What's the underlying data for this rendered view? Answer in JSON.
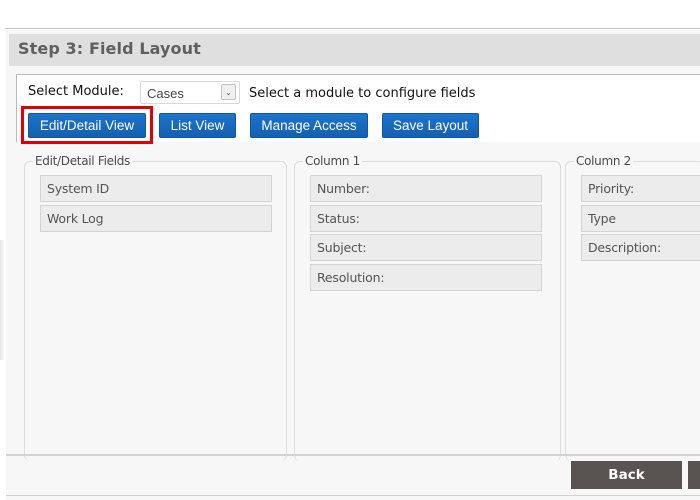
{
  "step_header": {
    "title": "Step 3: Field Layout"
  },
  "module_selector": {
    "label": "Select Module:",
    "selected_value": "Cases",
    "hint": "Select a module to configure fields",
    "arrow_icon": "chevron-down-icon"
  },
  "toolbar": {
    "buttons": [
      {
        "label": "Edit/Detail View",
        "highlighted": true
      },
      {
        "label": "List View"
      },
      {
        "label": "Manage Access"
      },
      {
        "label": "Save Layout"
      }
    ],
    "highlight_color": "#e00000",
    "button_color": "#1a6bc0"
  },
  "panels": {
    "edit_detail": {
      "legend": "Edit/Detail Fields",
      "fields": [
        "System ID",
        "Work Log"
      ]
    },
    "column1": {
      "legend": "Column 1",
      "fields": [
        "Number:",
        "Status:",
        "Subject:",
        "Resolution:"
      ]
    },
    "column2": {
      "legend": "Column 2",
      "fields": [
        "Priority:",
        "Type",
        "Description:"
      ]
    }
  },
  "footer": {
    "back_label": "Back",
    "button_color": "#595452"
  }
}
